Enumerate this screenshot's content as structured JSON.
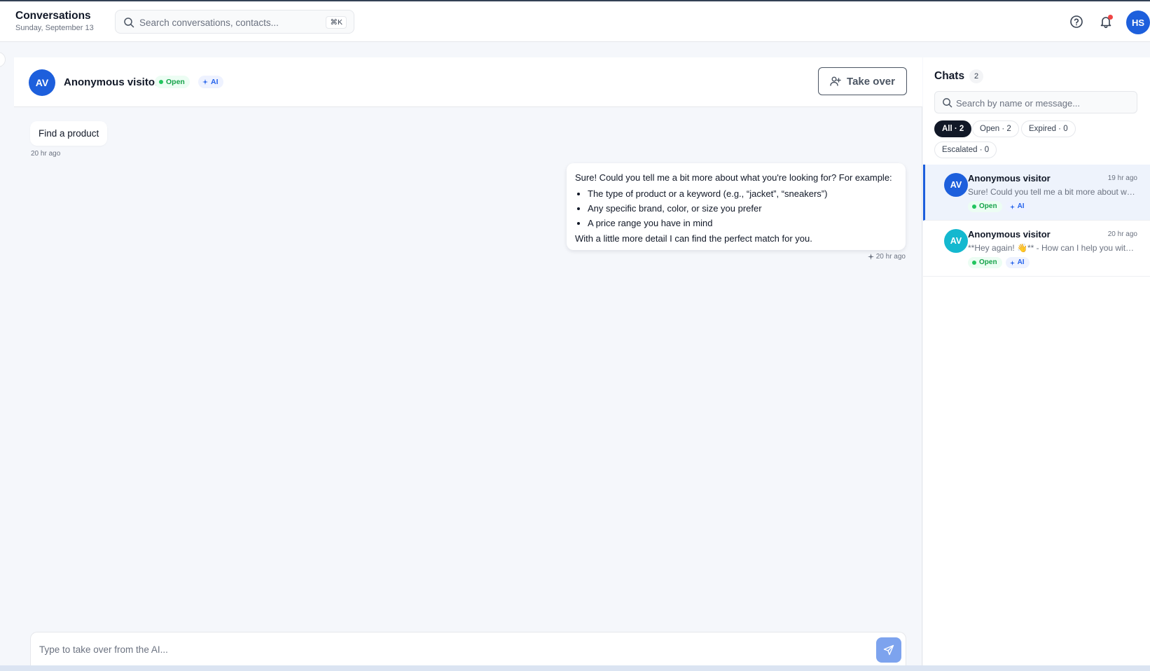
{
  "header": {
    "title": "Conversations",
    "date": "Sunday, September 13",
    "search_placeholder": "Search conversations, contacts...",
    "search_shortcut": "⌘K",
    "user_initials": "HS",
    "icons": [
      "help-icon",
      "bell-icon"
    ]
  },
  "conversation": {
    "avatar_initials": "AV",
    "name": "Anonymous visitor",
    "status": "Open",
    "ai_label": "AI",
    "take_over_label": "Take over",
    "messages": [
      {
        "from": "visitor",
        "text": "Find a product",
        "time": "20 hr ago"
      },
      {
        "from": "ai",
        "intro": "Sure! Could you tell me a bit more about what you're looking for? For example:",
        "bullets": [
          "The type of product or a keyword (e.g., “jacket”, “sneakers”)",
          "Any specific brand, color, or size you prefer",
          "A price range you have in mind"
        ],
        "outro": "With a little more detail I can find the perfect match for you.",
        "time": "20 hr ago"
      }
    ],
    "composer_placeholder": "Type to take over from the AI..."
  },
  "chats": {
    "title": "Chats",
    "count": "2",
    "search_placeholder": "Search by name or message...",
    "filters": [
      "All · 2",
      "Open · 2",
      "Expired · 0",
      "Escalated · 0"
    ],
    "items": [
      {
        "initials": "AV",
        "name": "Anonymous visitor",
        "time": "19 hr ago",
        "preview": "Sure! Could you tell me a bit more about what you're looking for?",
        "status": "Open",
        "ai": "AI",
        "avatar_color": "#1d5fdc"
      },
      {
        "initials": "AV",
        "name": "Anonymous visitor",
        "time": "20 hr ago",
        "preview": "**Hey again! 👋** - How can I help you with your shopping today?",
        "status": "Open",
        "ai": "AI",
        "avatar_color": "#14b8cf"
      }
    ]
  },
  "colors": {
    "accent": "#1d5fdc",
    "open_green": "#16a34a",
    "ai_blue": "#2563eb",
    "send_button": "#7da3ee"
  }
}
